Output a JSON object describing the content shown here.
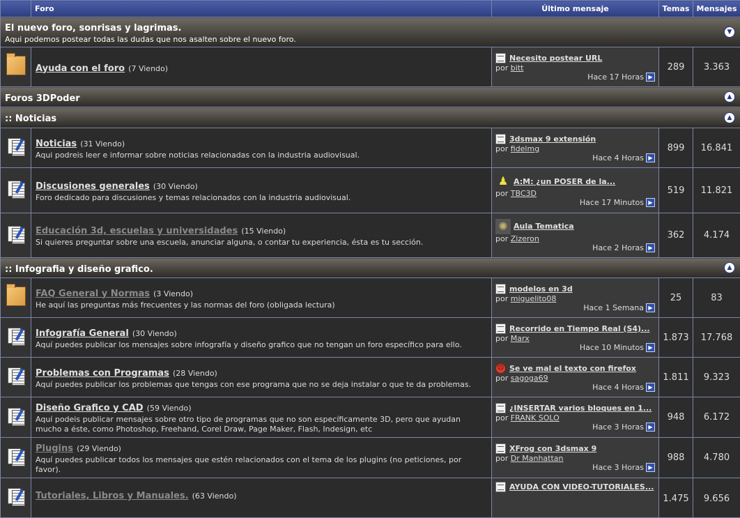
{
  "header": {
    "forum": "Foro",
    "last_post": "Último mensaje",
    "topics": "Temas",
    "posts": "Mensajes"
  },
  "categories": [
    {
      "name": "El nuevo foro, sonrisas y lagrimas.",
      "description": "Aqui podemos postear todas las dudas que nos asalten sobre el nuevo foro.",
      "toggle": "collapse-icon"
    },
    {
      "name": "Foros 3DPoder",
      "toggle": "expand-icon"
    },
    {
      "name": ":: Noticias",
      "toggle": "expand-icon"
    },
    {
      "name": ":: Infografia y diseño grafico.",
      "toggle": "expand-icon"
    }
  ],
  "forums": [
    {
      "name": "Ayuda con el foro",
      "viewing": "(7 Viendo)",
      "description": "",
      "icon": "folder-icon",
      "last": {
        "title": "Necesito postear URL",
        "by": "por",
        "user": "bitt",
        "when": "Hace 17 Horas",
        "icon": "post-icon"
      },
      "topics": "289",
      "posts": "3.363"
    },
    {
      "name": "Noticias",
      "viewing": "(31 Viendo)",
      "description": "Aqui podreis leer e informar sobre noticias relacionadas con la industria audiovisual.",
      "icon": "docs-icon",
      "last": {
        "title": "3dsmax 9 extensión",
        "by": "por",
        "user": "fidelmg",
        "when": "Hace 4 Horas",
        "icon": "post-icon"
      },
      "topics": "899",
      "posts": "16.841"
    },
    {
      "name": "Discusiones generales",
      "viewing": "(30 Viendo)",
      "description": "Foro dedicado para discusiones y temas relacionados con la industria audiovisual.",
      "icon": "docs-icon",
      "last": {
        "title": "A:M: ¿un POSER de la...",
        "by": "por",
        "user": "TBC3D",
        "when": "Hace 17 Minutos",
        "icon": "user-avatar-icon"
      },
      "topics": "519",
      "posts": "11.821"
    },
    {
      "name": "Educación 3d, escuelas y universidades",
      "viewing": "(15 Viendo)",
      "description": "Si quieres preguntar sobre una escuela, anunciar alguna, o contar tu experiencia, ésta es tu sección.",
      "icon": "docs-icon",
      "visited": true,
      "last": {
        "title": "Aula Tematica",
        "by": "por",
        "user": "Zizeron",
        "when": "Hace 2 Horas",
        "icon": "user-avatar-icon"
      },
      "topics": "362",
      "posts": "4.174"
    },
    {
      "name": "FAQ General y Normas",
      "viewing": "(3 Viendo)",
      "description": "He aquí las preguntas más frecuentes y las normas del foro (obligada lectura)",
      "icon": "folder-icon",
      "visited": true,
      "last": {
        "title": "modelos en 3d",
        "by": "por",
        "user": "miguelito08",
        "when": "Hace 1 Semana",
        "icon": "post-icon"
      },
      "topics": "25",
      "posts": "83"
    },
    {
      "name": "Infografía General",
      "viewing": "(30 Viendo)",
      "description": "Aquí puedes publicar los mensajes sobre infografía y diseño grafico que no tengan un foro específico para ello.",
      "icon": "docs-icon",
      "last": {
        "title": "Recorrido en Tiempo Real (S4)...",
        "by": "por",
        "user": "Marx",
        "when": "Hace 10 Minutos",
        "icon": "post-icon"
      },
      "topics": "1.873",
      "posts": "17.768"
    },
    {
      "name": "Problemas con Programas",
      "viewing": "(28 Viendo)",
      "description": "Aquí puedes publicar los problemas que tengas con ese programa que no se deja instalar o que te da problemas.",
      "icon": "docs-icon",
      "last": {
        "title": "Se ve mal el texto con firefox",
        "by": "por",
        "user": "sagoga69",
        "when": "Hace 4 Horas",
        "icon": "angry-smiley-icon"
      },
      "topics": "1.811",
      "posts": "9.323"
    },
    {
      "name": "Diseño Grafico y CAD",
      "viewing": "(59 Viendo)",
      "description": "Aquí podeis publicar mensajes sobre otro tipo de programas que no son específicamente 3D, pero que ayudan mucho a éste, como Photoshop, Freehand, Corel Draw, Page Maker, Flash, Indesign, etc",
      "icon": "docs-icon",
      "last": {
        "title": "¿INSERTAR varios bloques en 1...",
        "by": "por",
        "user": "FRANK SOLO",
        "when": "Hace 3 Horas",
        "icon": "post-icon"
      },
      "topics": "948",
      "posts": "6.172"
    },
    {
      "name": "Plugins",
      "viewing": "(29 Viendo)",
      "description": "Aquí puedes publicar todos los mensajes que estén relacionados con el tema de los plugins (no peticiones, por favor).",
      "icon": "docs-icon",
      "visited": true,
      "last": {
        "title": "XFrog con 3dsmax 9",
        "by": "por",
        "user": "Dr Manhattan",
        "when": "Hace 3 Horas",
        "icon": "post-icon"
      },
      "topics": "988",
      "posts": "4.780"
    },
    {
      "name": "Tutoriales, Libros y Manuales.",
      "viewing": "(63 Viendo)",
      "description": "",
      "icon": "docs-icon",
      "visited": true,
      "last": {
        "title": "AYUDA CON VIDEO-TUTORIALES...",
        "by": "",
        "user": "",
        "when": "",
        "icon": "post-icon"
      },
      "topics": "1.475",
      "posts": "9.656"
    }
  ],
  "colors": {
    "header": "#3a4c96",
    "border": "#7b86a8",
    "row_bg": "#2b2b2b",
    "page_bg": "#4a4a4a"
  }
}
